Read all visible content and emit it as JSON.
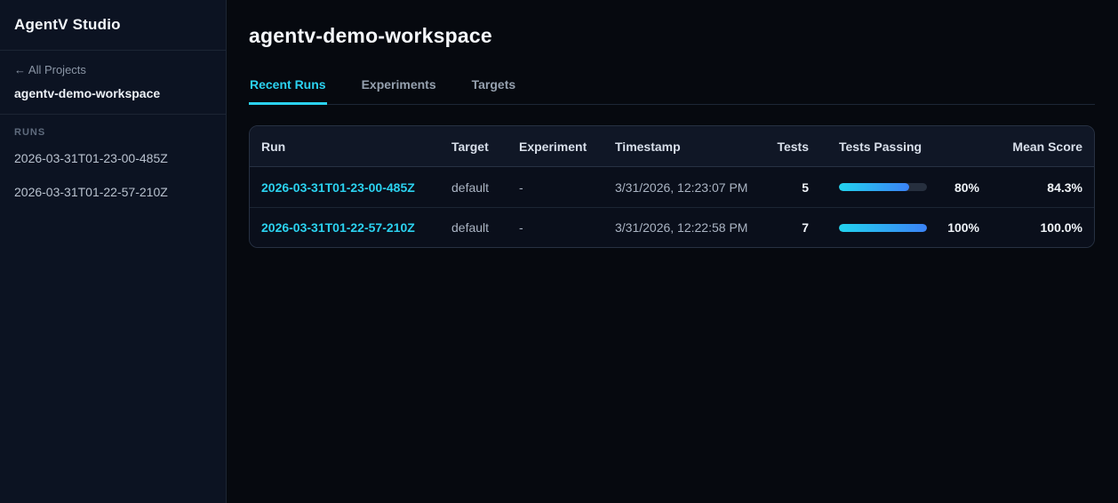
{
  "sidebar": {
    "app_title": "AgentV Studio",
    "back_link": "← All Projects",
    "project_name": "agentv-demo-workspace",
    "runs_section_label": "RUNS",
    "runs": [
      "2026-03-31T01-23-00-485Z",
      "2026-03-31T01-22-57-210Z"
    ]
  },
  "main": {
    "page_title": "agentv-demo-workspace",
    "tabs": [
      {
        "label": "Recent Runs",
        "active": true
      },
      {
        "label": "Experiments",
        "active": false
      },
      {
        "label": "Targets",
        "active": false
      }
    ]
  },
  "table": {
    "columns": [
      "Run",
      "Target",
      "Experiment",
      "Timestamp",
      "Tests",
      "Tests Passing",
      "Mean Score"
    ],
    "rows": [
      {
        "run": "2026-03-31T01-23-00-485Z",
        "target": "default",
        "experiment": "-",
        "timestamp": "3/31/2026, 12:23:07 PM",
        "tests": "5",
        "tests_passing_pct": 80,
        "tests_passing_label": "80%",
        "mean_score": "84.3%"
      },
      {
        "run": "2026-03-31T01-22-57-210Z",
        "target": "default",
        "experiment": "-",
        "timestamp": "3/31/2026, 12:22:58 PM",
        "tests": "7",
        "tests_passing_pct": 100,
        "tests_passing_label": "100%",
        "mean_score": "100.0%"
      }
    ]
  },
  "colors": {
    "accent": "#2bd2f0",
    "progress_from": "#22d3ee",
    "progress_to": "#3b82f6"
  }
}
